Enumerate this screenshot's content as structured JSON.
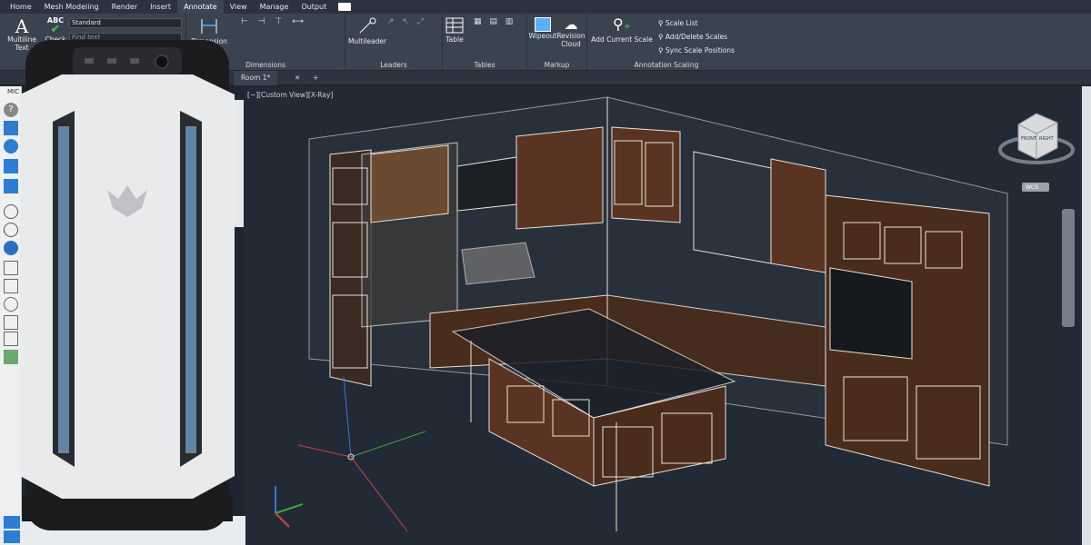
{
  "ribbon_tabs": [
    "Home",
    "Mesh Modeling",
    "Render",
    "Insert",
    "Annotate",
    "View",
    "Manage",
    "Output"
  ],
  "active_tab": "Annotate",
  "text_panel": {
    "multiline_label": "Multiline Text",
    "check_label": "Check Spelling",
    "abc": "ABC",
    "style_value": "Standard",
    "find_placeholder": "Find text"
  },
  "dimension_panel": {
    "button": "Dimension",
    "title": "Dimensions"
  },
  "leaders_panel": {
    "button": "Multileader",
    "title": "Leaders"
  },
  "tables_panel": {
    "button": "Table",
    "title": "Tables"
  },
  "markup_panel": {
    "wipeout": "Wipeout",
    "revision": "Revision Cloud",
    "title": "Markup"
  },
  "scaling_panel": {
    "add_scale": "Add Current Scale",
    "scale_list": "Scale List",
    "add_delete": "Add/Delete Scales",
    "sync": "Sync Scale Positions",
    "title": "Annotation Scaling"
  },
  "doc_tabs": [
    "Room 1*"
  ],
  "viewport_label": "[−][Custom View][X-Ray]",
  "viewcube": {
    "front": "FRONT",
    "right": "RIGHT",
    "wcs": "WCS"
  },
  "palette_label": "MIC",
  "colors": {
    "ribbon": "#3a4350",
    "viewport": "#222a36",
    "wire": "#e8e2d8",
    "wood": "#5a3422"
  }
}
